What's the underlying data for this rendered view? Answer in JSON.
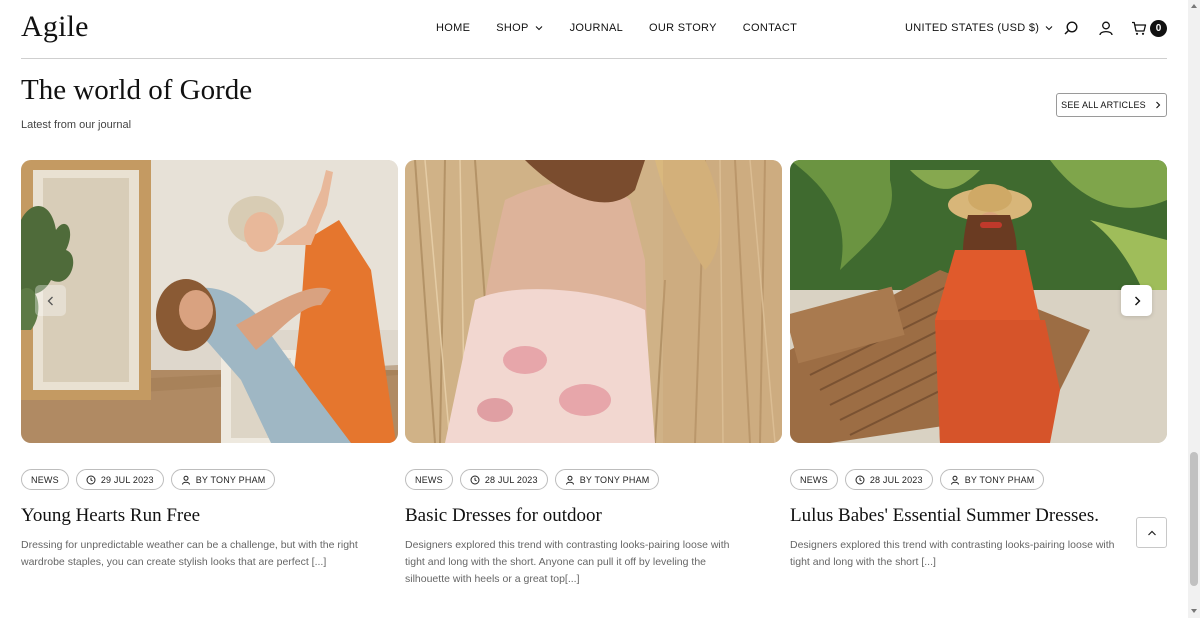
{
  "header": {
    "logo": "Agile",
    "nav": [
      {
        "label": "HOME"
      },
      {
        "label": "SHOP"
      },
      {
        "label": "JOURNAL"
      },
      {
        "label": "OUR STORY"
      },
      {
        "label": "CONTACT"
      }
    ],
    "currency": "UNITED STATES (USD $)",
    "cart_count": "0"
  },
  "section": {
    "title": "The world of Gorde",
    "subtitle": "Latest from our journal",
    "see_all": "SEE ALL ARTICLES"
  },
  "cards": [
    {
      "category": "NEWS",
      "date": "29 JUL 2023",
      "author": "BY TONY PHAM",
      "title": "Young Hearts Run Free",
      "excerpt": "Dressing for unpredictable weather can be a challenge, but with the right wardrobe staples, you can create stylish looks that are perfect [...]"
    },
    {
      "category": "NEWS",
      "date": "28 JUL 2023",
      "author": "BY TONY PHAM",
      "title": "Basic Dresses for outdoor",
      "excerpt": "Designers explored this trend with contrasting looks-pairing loose with tight and long with the short. Anyone can pull it off by leveling the silhouette with heels or a great top[...]"
    },
    {
      "category": "NEWS",
      "date": "28 JUL 2023",
      "author": "BY TONY PHAM",
      "title": "Lulus Babes' Essential Summer Dresses.",
      "excerpt": "Designers explored this trend with contrasting looks-pairing loose with tight and long with the short [...]"
    }
  ],
  "colors": {
    "text": "#111111",
    "muted": "#666666",
    "border": "#bdbdbd"
  },
  "icons": [
    "search-icon",
    "user-icon",
    "cart-icon",
    "chevron-down-icon",
    "chevron-left-icon",
    "chevron-right-icon",
    "chevron-up-icon",
    "clock-icon",
    "person-icon"
  ]
}
